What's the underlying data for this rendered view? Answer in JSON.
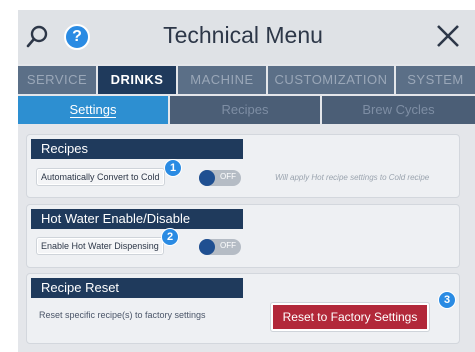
{
  "header": {
    "title": "Technical Menu",
    "help_label": "?"
  },
  "tabs": [
    {
      "label": "SERVICE",
      "active": false
    },
    {
      "label": "DRINKS",
      "active": true
    },
    {
      "label": "MACHINE",
      "active": false
    },
    {
      "label": "CUSTOMIZATION",
      "active": false
    },
    {
      "label": "SYSTEM",
      "active": false
    }
  ],
  "subtabs": [
    {
      "label": "Settings",
      "active": true
    },
    {
      "label": "Recipes",
      "active": false
    },
    {
      "label": "Brew Cycles",
      "active": false
    }
  ],
  "recipes": {
    "heading": "Recipes",
    "field_label": "Automatically Convert to Cold",
    "toggle_state": "OFF",
    "hint": "Will apply Hot recipe settings to Cold recipe",
    "callout": "1"
  },
  "hot_water": {
    "heading": "Hot Water Enable/Disable",
    "field_label": "Enable Hot Water Dispensing",
    "toggle_state": "OFF",
    "callout": "2"
  },
  "recipe_reset": {
    "heading": "Recipe Reset",
    "description": "Reset specific recipe(s) to factory settings",
    "button_label": "Reset to Factory Settings",
    "callout": "3"
  },
  "colors": {
    "header_bg": "#dfe2e6",
    "tab_active": "#1f3a5c",
    "tab_inactive": "#5b6f87",
    "subtab_active": "#2d8fd1",
    "reset_button": "#b2283a",
    "callout": "#2a8be3"
  },
  "icons": {
    "search": "search-icon",
    "help": "help-icon",
    "close": "close-icon"
  }
}
